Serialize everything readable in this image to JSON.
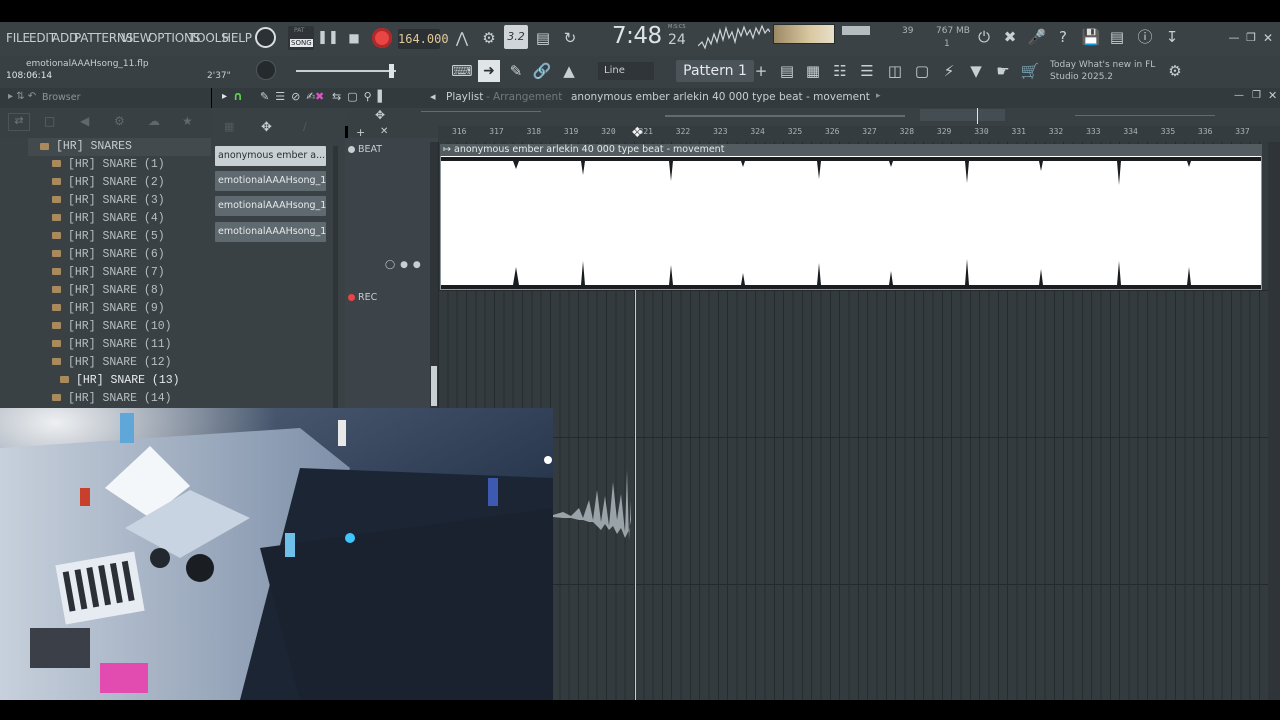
{
  "menu": {
    "items": [
      "FILE",
      "EDIT",
      "ADD",
      "PATTERNS",
      "VIEW",
      "OPTIONS",
      "TOOLS",
      "HELP"
    ]
  },
  "transport": {
    "mode_label": "SONG",
    "mode_pat_label": "PAT",
    "bpm": "164.000",
    "time_main": "7:48",
    "time_sub": "24",
    "time_label": "M:S:CS",
    "snap_label": "3.2",
    "cpu_value": "39",
    "memory": "767 MB",
    "poly": "1"
  },
  "project": {
    "filename": "emotionalAAAHsong_11.flp",
    "elapsed": "108:06:14",
    "duration": "2'37\""
  },
  "toolbar": {
    "line_label": "Line",
    "pattern_label": "Pattern 1",
    "news_line1": "Today  What's new in FL",
    "news_line2": "Studio 2025.2"
  },
  "browser": {
    "title": "Browser",
    "root_folder": "[HR] SNARES",
    "items": [
      "[HR] SNARE (1)",
      "[HR] SNARE (2)",
      "[HR] SNARE (3)",
      "[HR] SNARE (4)",
      "[HR] SNARE (5)",
      "[HR] SNARE (6)",
      "[HR] SNARE (7)",
      "[HR] SNARE (8)",
      "[HR] SNARE (9)",
      "[HR] SNARE (10)",
      "[HR] SNARE (11)",
      "[HR] SNARE (12)",
      "[HR] SNARE (13)",
      "[HR] SNARE (14)"
    ],
    "selected_index": 12
  },
  "playlist": {
    "title": "Playlist",
    "subtitle": "Arrangement",
    "song_title": "anonymous ember  arlekin 40 000 type beat - movement",
    "clips_list": [
      "anonymous ember  a...",
      "emotionalAAAHsong_11_...",
      "emotionalAAAHsong_11_...",
      "emotionalAAAHsong_11_..."
    ],
    "tracks": [
      "BEAT",
      "REC"
    ],
    "clip_label": "anonymous ember  arlekin 40 000 type beat - movement",
    "ruler_ticks": [
      "316",
      "317",
      "318",
      "319",
      "320",
      "321",
      "322",
      "323",
      "324",
      "325",
      "326",
      "327",
      "328",
      "329",
      "330",
      "331",
      "332",
      "333",
      "334",
      "335",
      "336",
      "337"
    ]
  },
  "colors": {
    "accent_record": "#e84545",
    "accent_magnet": "#59d64a",
    "bpm_text": "#e0c99a",
    "panel": "#3a4145"
  }
}
